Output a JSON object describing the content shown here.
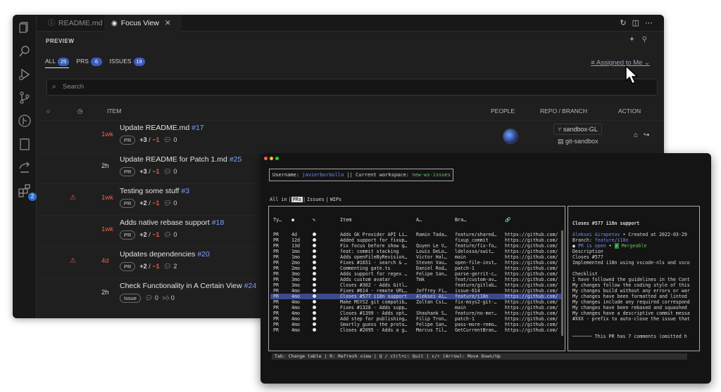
{
  "vscode": {
    "tabs": [
      {
        "icon": "ⓘ",
        "label": "README.md"
      },
      {
        "icon": "◉",
        "label": "Focus View",
        "close": "✕"
      }
    ],
    "preview_label": "PREVIEW",
    "filters": [
      {
        "label": "ALL",
        "count": "25"
      },
      {
        "label": "PRS",
        "count": "6"
      },
      {
        "label": "ISSUES",
        "count": "19"
      }
    ],
    "assigned_filter": "Assigned to Me",
    "search_placeholder": "Search",
    "columns": {
      "item": "ITEM",
      "people": "PEOPLE",
      "repo": "REPO / BRANCH",
      "action": "ACTION"
    },
    "activity_badge": "2",
    "rows": [
      {
        "age": "1wk",
        "age_red": true,
        "title": "Update README.md",
        "num": "#17",
        "type": "PR",
        "add": "+3",
        "del": "−1",
        "comments": "0",
        "repo": "sandbox-GL",
        "branch": "git-sandbox"
      },
      {
        "age": "2h",
        "age_red": false,
        "title": "Update README for Patch 1.md",
        "num": "#25",
        "type": "PR",
        "add": "+3",
        "del": "−1",
        "comments": "0"
      },
      {
        "age": "1wk",
        "age_red": true,
        "title": "Testing some stuff",
        "num": "#3",
        "type": "PR",
        "add": "+2",
        "del": "−1",
        "comments": "0"
      },
      {
        "age": "1wk",
        "age_red": true,
        "title": "Adds native rebase support",
        "num": "#18",
        "type": "PR",
        "add": "+2",
        "del": "−1",
        "comments": "0"
      },
      {
        "age": "4d",
        "age_red": true,
        "title": "Updates dependencies",
        "num": "#20",
        "type": "PR",
        "add": "+2",
        "del": "−1",
        "comments": "2"
      },
      {
        "age": "2h",
        "age_red": false,
        "title": "Check Functionality in A Certain View",
        "num": "#24",
        "type": "Issue",
        "comments": "0",
        "likes": "0"
      }
    ]
  },
  "terminal": {
    "username_label": "Username:",
    "username": "javierborbolla",
    "workspace_label": "|| Current workspace:",
    "workspace": "new-ws-issues",
    "tabs": [
      "All in",
      "PRs",
      "Issues",
      "WIPs"
    ],
    "columns": [
      "Ty…",
      "●",
      "✎",
      "Item",
      "A…",
      "Bra…",
      "🔗"
    ],
    "rows": [
      [
        "PR",
        "4d",
        "Adds GK Provider API Li…",
        "Ramin Tada…",
        "feature/shared…",
        "https://github.com/"
      ],
      [
        "PR",
        "12d",
        "Added support for fixup…",
        "",
        "fixup_commit",
        "https://github.com/"
      ],
      [
        "PR",
        "13d",
        "Fix focus before show q…",
        "Quyen Le V…",
        "feature/fix-fo…",
        "https://github.com/"
      ],
      [
        "PR",
        "1mo",
        "feat: commit stacking",
        "Louis DeLo…",
        "ldelossa/swit…",
        "https://github.com/"
      ],
      [
        "PR",
        "1mo",
        "Adds openFileByRevision…",
        "Victor Hal…",
        "main",
        "https://github.com/"
      ],
      [
        "PR",
        "2mo",
        "Fixes #1651 - search & …",
        "Steven Vau…",
        "open-file-inst…",
        "https://github.com/"
      ],
      [
        "PR",
        "2mo",
        "Commenting gate.ts",
        "Daniel Rod…",
        "patch-1",
        "https://github.com/"
      ],
      [
        "PR",
        "3mo",
        "Adds support for regex …",
        "Felipe San…",
        "parse-gerrit-c…",
        "https://github.com/"
      ],
      [
        "PR",
        "3mo",
        "Adds custom avatar",
        "Tmk",
        "feat/custom-av…",
        "https://github.com/"
      ],
      [
        "PR",
        "3mo",
        "Closes #302 - Adds Gitl…",
        "",
        "feature/gitlab…",
        "https://github.com/"
      ],
      [
        "PR",
        "4mo",
        "Fixes #614 - remote URL…",
        "Jeffrey Fi…",
        "issue-614",
        "https://github.com/"
      ],
      [
        "PR",
        "4mo",
        "Closes #577 i18n support",
        "Aleksei Ai…",
        "feature/i18n",
        "https://github.com/"
      ],
      [
        "PR",
        "4mo",
        "Make MSYS2 git compatib…",
        "Zoltan Csi…",
        "fix-msys2-git-…",
        "https://github.com/"
      ],
      [
        "PR",
        "4mo",
        "Fixes #1328 - Adds supp…",
        "",
        "main",
        "https://github.com/"
      ],
      [
        "PR",
        "4mo",
        "Closes #1399 - Adds opt…",
        "Shashank S…",
        "feature/no-mer…",
        "https://github.com/"
      ],
      [
        "PR",
        "4mo",
        "Add step for publishing…",
        "Filip Tron…",
        "patch-1",
        "https://github.com/"
      ],
      [
        "PR",
        "4mo",
        "Smartly guess the proto…",
        "Felipe San…",
        "pass-more-remo…",
        "https://github.com/"
      ],
      [
        "PR",
        "4mo",
        "Closes #2095 - Adds a g…",
        "Marcus Til…",
        "GetCurrentBran…",
        "https://github.com/"
      ]
    ],
    "selected_row": 11,
    "detail": {
      "title": "Closes #577 i18n support",
      "author": "Aleksei Airapetov",
      "created": "• Created at 2022-03-29",
      "branch_label": "Branch:",
      "branch": "feature/i18n",
      "state_bullet": "●",
      "state": "PR is open",
      "mergeable_sep": "•",
      "mergeable_check": "✓",
      "mergeable": "Mergeable",
      "lines": [
        "Description",
        "Closes #577",
        "Implemented i18n using vscode-nls and vsco",
        "",
        "Checklist",
        "I have followed the guidelines in the Cont",
        "My changes follow the coding style of this",
        "My changes build without any errors or war",
        "My changes have been formatted and linted",
        "My changes include any required correspond",
        "My changes have been rebased and squashed",
        "My changes have a descriptive commit messa",
        "#XXX - prefix to auto-close the issue that"
      ],
      "comments_note": "─────── This PR has 7 comments (omitted h"
    },
    "footer": "Tab: Change table | R: Refresh view | Q / ctrl+c: Quit | ↕/↑ (Arrow): Move Down/Up"
  }
}
